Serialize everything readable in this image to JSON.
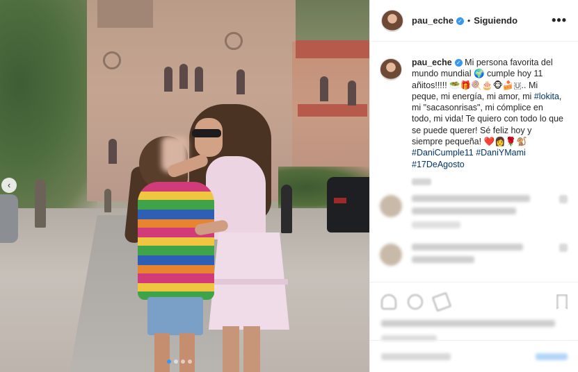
{
  "header": {
    "username": "pau_eche",
    "separator": "•",
    "follow_status": "Siguiendo",
    "more_label": "•••"
  },
  "caption": {
    "username": "pau_eche",
    "text_1": "Mi persona favorita del mundo mundial 🌍 cumple hoy 11 añitos!!!!! 🥗🎁🍭🎂🐵🍰🇺.. Mi peque, mi energía, mi amor, mi ",
    "hashtag_lokita": "#lokita",
    "text_2": ", mi \"sacasonrisas\", mi cómplice en todo, mi vida! Te quiero con todo lo que se puede querer! Sé feliz hoy y siempre pequeña! ❤️👩🌹🐒",
    "hashtag_1": "#DaniCumple11",
    "hashtag_2": "#DaniYMami",
    "hashtag_3": "#17DeAgosto"
  },
  "photo": {
    "prev_label": "‹",
    "dots": [
      true,
      false,
      false,
      false
    ]
  },
  "icons": {
    "verified": "verified-badge-icon",
    "like": "heart-icon",
    "comment": "comment-bubble-icon",
    "share": "share-icon",
    "save": "bookmark-icon"
  },
  "colors": {
    "accent": "#3897f0",
    "hashtag": "#003569",
    "text": "#262626"
  }
}
